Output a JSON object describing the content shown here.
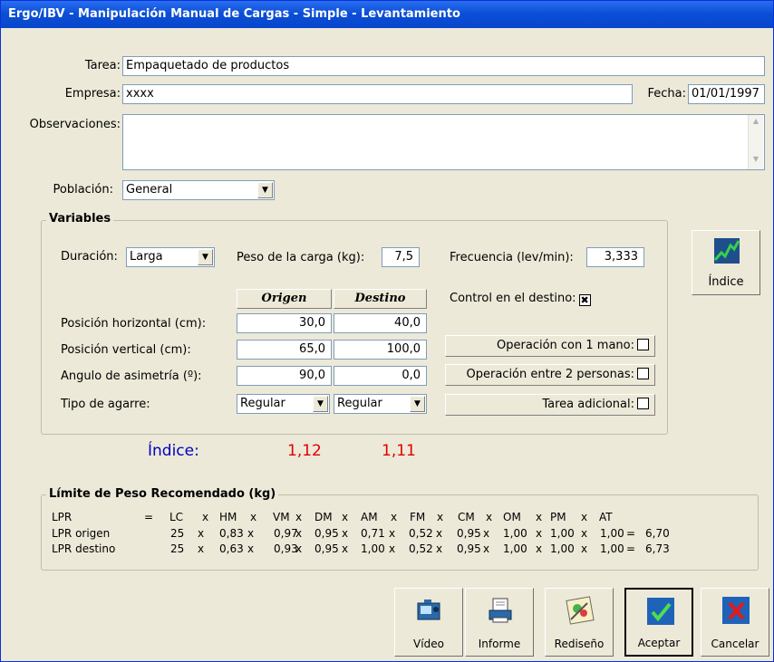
{
  "window": {
    "title": "Ergo/IBV - Manipulación Manual de Cargas - Simple - Levantamiento"
  },
  "form": {
    "tarea_label": "Tarea:",
    "tarea_value": "Empaquetado de productos",
    "empresa_label": "Empresa:",
    "empresa_value": "xxxx",
    "fecha_label": "Fecha:",
    "fecha_value": "01/01/1997",
    "observaciones_label": "Observaciones:",
    "observaciones_value": "",
    "poblacion_label": "Población:",
    "poblacion_value": "General"
  },
  "variables": {
    "legend": "Variables",
    "duracion_label": "Duración:",
    "duracion_value": "Larga",
    "peso_label": "Peso de la carga (kg):",
    "peso_value": "7,5",
    "frecuencia_label": "Frecuencia (lev/min):",
    "frecuencia_value": "3,333",
    "origen_header": "Origen",
    "destino_header": "Destino",
    "control_label": "Control en el destino:",
    "control_checked": true,
    "rows": [
      {
        "label": "Posición horizontal (cm):",
        "origen": "30,0",
        "destino": "40,0"
      },
      {
        "label": "Posición vertical (cm):",
        "origen": "65,0",
        "destino": "100,0"
      },
      {
        "label": "Angulo de asimetría (º):",
        "origen": "90,0",
        "destino": "0,0"
      }
    ],
    "agarre_label": "Tipo de agarre:",
    "agarre_origen": "Regular",
    "agarre_destino": "Regular",
    "op1_label": "Operación con 1 mano:",
    "op2_label": "Operación entre 2 personas:",
    "tarea_adicional_label": "Tarea adicional:"
  },
  "indice_button": {
    "label": "Índice",
    "icon": "chart-icon"
  },
  "indice": {
    "label": "Índice:",
    "origen": "1,12",
    "destino": "1,11",
    "value_color": "#e00000",
    "label_color": "#0000c0"
  },
  "lpr": {
    "legend": "Límite de Peso Recomendado (kg)",
    "header": [
      "LPR",
      "=",
      "LC",
      "x",
      "HM",
      "x",
      "VM",
      "x",
      "DM",
      "x",
      "AM",
      "x",
      "FM",
      "x",
      "CM",
      "x",
      "OM",
      "x",
      "PM",
      "x",
      "AT"
    ],
    "origen": [
      "LPR origen",
      "25",
      "x",
      "0,83",
      "x",
      "0,97",
      "x",
      "0,95",
      "x",
      "0,71",
      "x",
      "0,52",
      "x",
      "0,95",
      "x",
      "1,00",
      "x",
      "1,00",
      "x",
      "1,00",
      "=",
      "6,70"
    ],
    "destino": [
      "LPR destino",
      "25",
      "x",
      "0,63",
      "x",
      "0,93",
      "x",
      "0,95",
      "x",
      "1,00",
      "x",
      "0,52",
      "x",
      "0,95",
      "x",
      "1,00",
      "x",
      "1,00",
      "x",
      "1,00",
      "=",
      "6,73"
    ]
  },
  "toolbar": {
    "video": "Vídeo",
    "informe": "Informe",
    "rediseno": "Rediseño",
    "aceptar": "Aceptar",
    "cancelar": "Cancelar"
  }
}
